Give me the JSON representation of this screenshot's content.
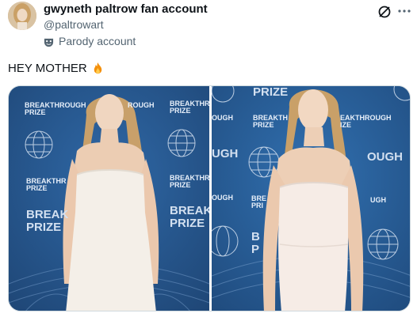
{
  "author": {
    "display_name": "gwyneth paltrow fan account",
    "handle": "@paltrowart",
    "parody_label": "Parody account",
    "avatar_icon": "avatar-photo"
  },
  "post": {
    "text": "HEY MOTHER",
    "emoji": "fire-emoji"
  },
  "backdrop": {
    "word1": "BREAKTHROUGH",
    "word1_partial_a": "ROUGH",
    "word1_partial_b": "BREAKTHROU",
    "word1_partial_c": "BREAKTHR",
    "word1_partial_d": "BREAKTHROU",
    "word2": "PRIZE",
    "big1": "BREAK",
    "big2": "PRIZE",
    "big3": "BREAKT",
    "big4": "PRIZE",
    "right_top": "PRIZE",
    "right_ough1": "OUGH",
    "right_break": "BREAKTH",
    "right_eakthrough": "EAKTHROUGH",
    "right_ize": "IZE",
    "right_ugh_big": "UGH",
    "right_ough_big": "OUGH",
    "right_ough2": "OUGH",
    "right_bre": "BRE",
    "right_pri": "PRI",
    "right_ugh_small": "UGH",
    "right_bl": "B",
    "right_pl": "P"
  },
  "colors": {
    "backdrop_blue": "#2a5a95",
    "dress": "#f3efe9",
    "text_secondary": "#536471"
  },
  "icons": {
    "grok": "grok-icon",
    "more": "more-options-icon",
    "parody": "parody-mask-icon"
  }
}
